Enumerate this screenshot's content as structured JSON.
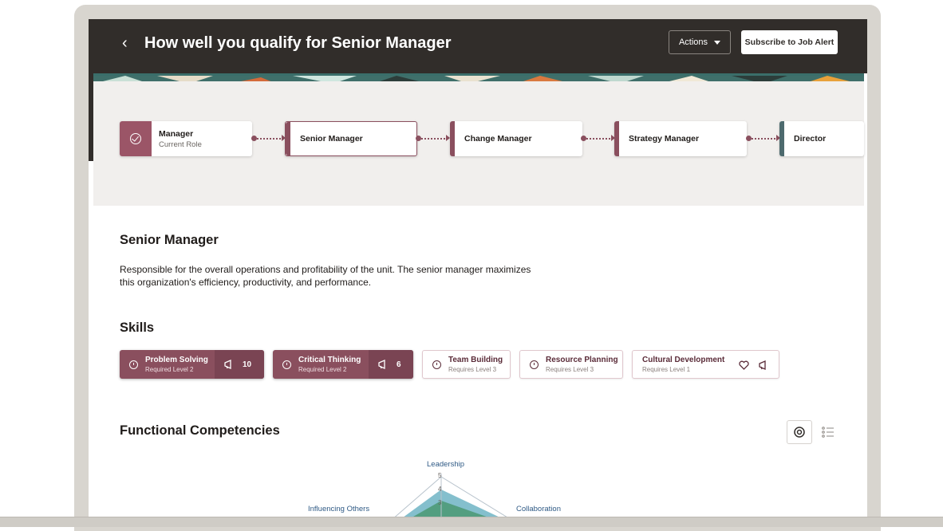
{
  "header": {
    "back_glyph": "‹",
    "title": "How well you qualify for Senior Manager",
    "actions_label": "Actions",
    "subscribe_label": "Subscribe to Job Alert"
  },
  "career_path": {
    "current": {
      "title": "Manager",
      "subtitle": "Current Role"
    },
    "steps": [
      "Senior Manager",
      "Change Manager",
      "Strategy Manager",
      "Director"
    ]
  },
  "role": {
    "title": "Senior Manager",
    "description": "Responsible for the overall operations and profitability of the unit. The senior manager maximizes this organization's efficiency, productivity, and performance."
  },
  "skills": {
    "heading": "Skills",
    "items": [
      {
        "name": "Problem Solving",
        "level": "Required Level 2",
        "count": "10"
      },
      {
        "name": "Critical Thinking",
        "level": "Required Level 2",
        "count": "6"
      },
      {
        "name": "Team Building",
        "level": "Requires Level 3"
      },
      {
        "name": "Resource Planning",
        "level": "Requires Level 3"
      },
      {
        "name": "Cultural Development",
        "level": "Requires Level 1"
      }
    ]
  },
  "competencies": {
    "heading": "Functional Competencies",
    "radar_labels": {
      "top": "Leadership",
      "left": "Influencing Others",
      "right": "Collaboration"
    },
    "scale_labels": [
      "5",
      "4",
      "3"
    ]
  },
  "colors": {
    "header_bg": "#312d2a",
    "accent": "#8a4f5e",
    "path_bg": "#f1efed"
  }
}
